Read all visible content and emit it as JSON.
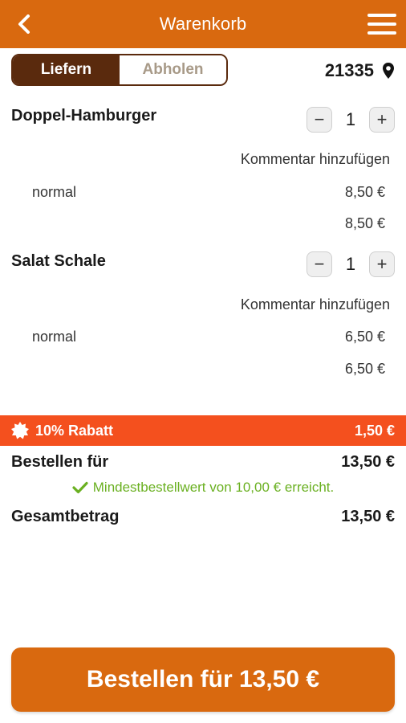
{
  "header": {
    "title": "Warenkorb"
  },
  "delivery_toggle": {
    "options": [
      "Liefern",
      "Abholen"
    ],
    "active": "Liefern"
  },
  "postal_code": "21335",
  "items": [
    {
      "name": "Doppel-Hamburger",
      "quantity": "1",
      "comment_label": "Kommentar hinzufügen",
      "option": "normal",
      "option_price": "8,50 €",
      "total": "8,50 €"
    },
    {
      "name": "Salat Schale",
      "quantity": "1",
      "comment_label": "Kommentar hinzufügen",
      "option": "normal",
      "option_price": "6,50 €",
      "total": "6,50 €"
    }
  ],
  "discount": {
    "label": "10% Rabatt",
    "amount": "1,50 €"
  },
  "order_for": {
    "label": "Bestellen für",
    "amount": "13,50 €"
  },
  "minimum_notice": "Mindestbestellwert von 10,00 € erreicht.",
  "grand_total": {
    "label": "Gesamtbetrag",
    "amount": "13,50 €"
  },
  "order_button": {
    "label": "Bestellen für 13,50 €"
  },
  "colors": {
    "brand": "#d9690f",
    "toggle_active": "#5a2a0d",
    "discount_bar": "#f4501e",
    "success": "#6ab021"
  },
  "icons": {
    "back": "chevron-left-icon",
    "menu": "hamburger-menu-icon",
    "location": "map-pin-icon",
    "discount": "starburst-badge-icon",
    "check": "check-icon"
  }
}
